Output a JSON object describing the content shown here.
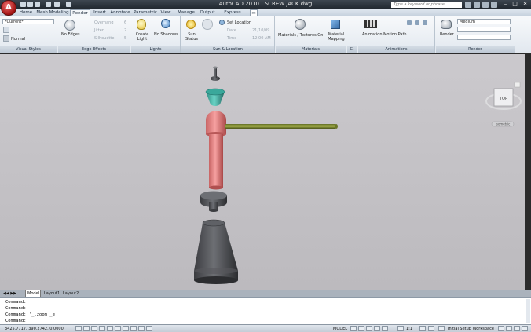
{
  "app_title": "AutoCAD 2010  ·  SCREW JACK.dwg",
  "search_placeholder": "Type a keyword or phrase",
  "tabs": [
    "Home",
    "Mesh Modeling",
    "Render",
    "Insert",
    "Annotate",
    "Parametric",
    "View",
    "Manage",
    "Output",
    "Express Tools"
  ],
  "active_tab": "Render",
  "ribbon": {
    "visual_styles": {
      "title": "Visual Styles",
      "current": "*Current*",
      "mode": "Normal"
    },
    "edge_effects": {
      "title": "Edge Effects",
      "edges": "No Edges",
      "overhang": "Overhang",
      "jitter": "Jitter",
      "silhouette": "Silhouette",
      "overhang_val": "6",
      "jitter_val": "2",
      "silhouette_val": "5"
    },
    "lights": {
      "title": "Lights",
      "create": "Create Light",
      "shadows": "No Shadows"
    },
    "sun_location": {
      "title": "Sun & Location",
      "sun_status": "Sun Status",
      "set_location": "Set Location",
      "date_label": "Date",
      "date_val": "21/10/09",
      "time_label": "Time",
      "time_val": "12:00 AM"
    },
    "materials": {
      "title": "Materials",
      "toggle": "Materials / Textures On",
      "mapping": "Material Mapping"
    },
    "animations": {
      "title": "Animations",
      "motion_path": "Animation Motion Path"
    },
    "render": {
      "title": "Render",
      "button": "Render",
      "quality": "Medium"
    }
  },
  "viewcube": {
    "face": "TOP",
    "label": "Isometric"
  },
  "layout_tabs": [
    "Model",
    "Layout1",
    "Layout2"
  ],
  "active_layout": "Model",
  "command_lines": [
    "Command:",
    "Command:",
    "Command:  '_.zoom _e",
    "Command:"
  ],
  "status": {
    "coords": "3425.7717, 390.2742, 0.0000",
    "model": "MODEL",
    "scale": "1:1",
    "workspace": "Initial Setup Workspace"
  }
}
